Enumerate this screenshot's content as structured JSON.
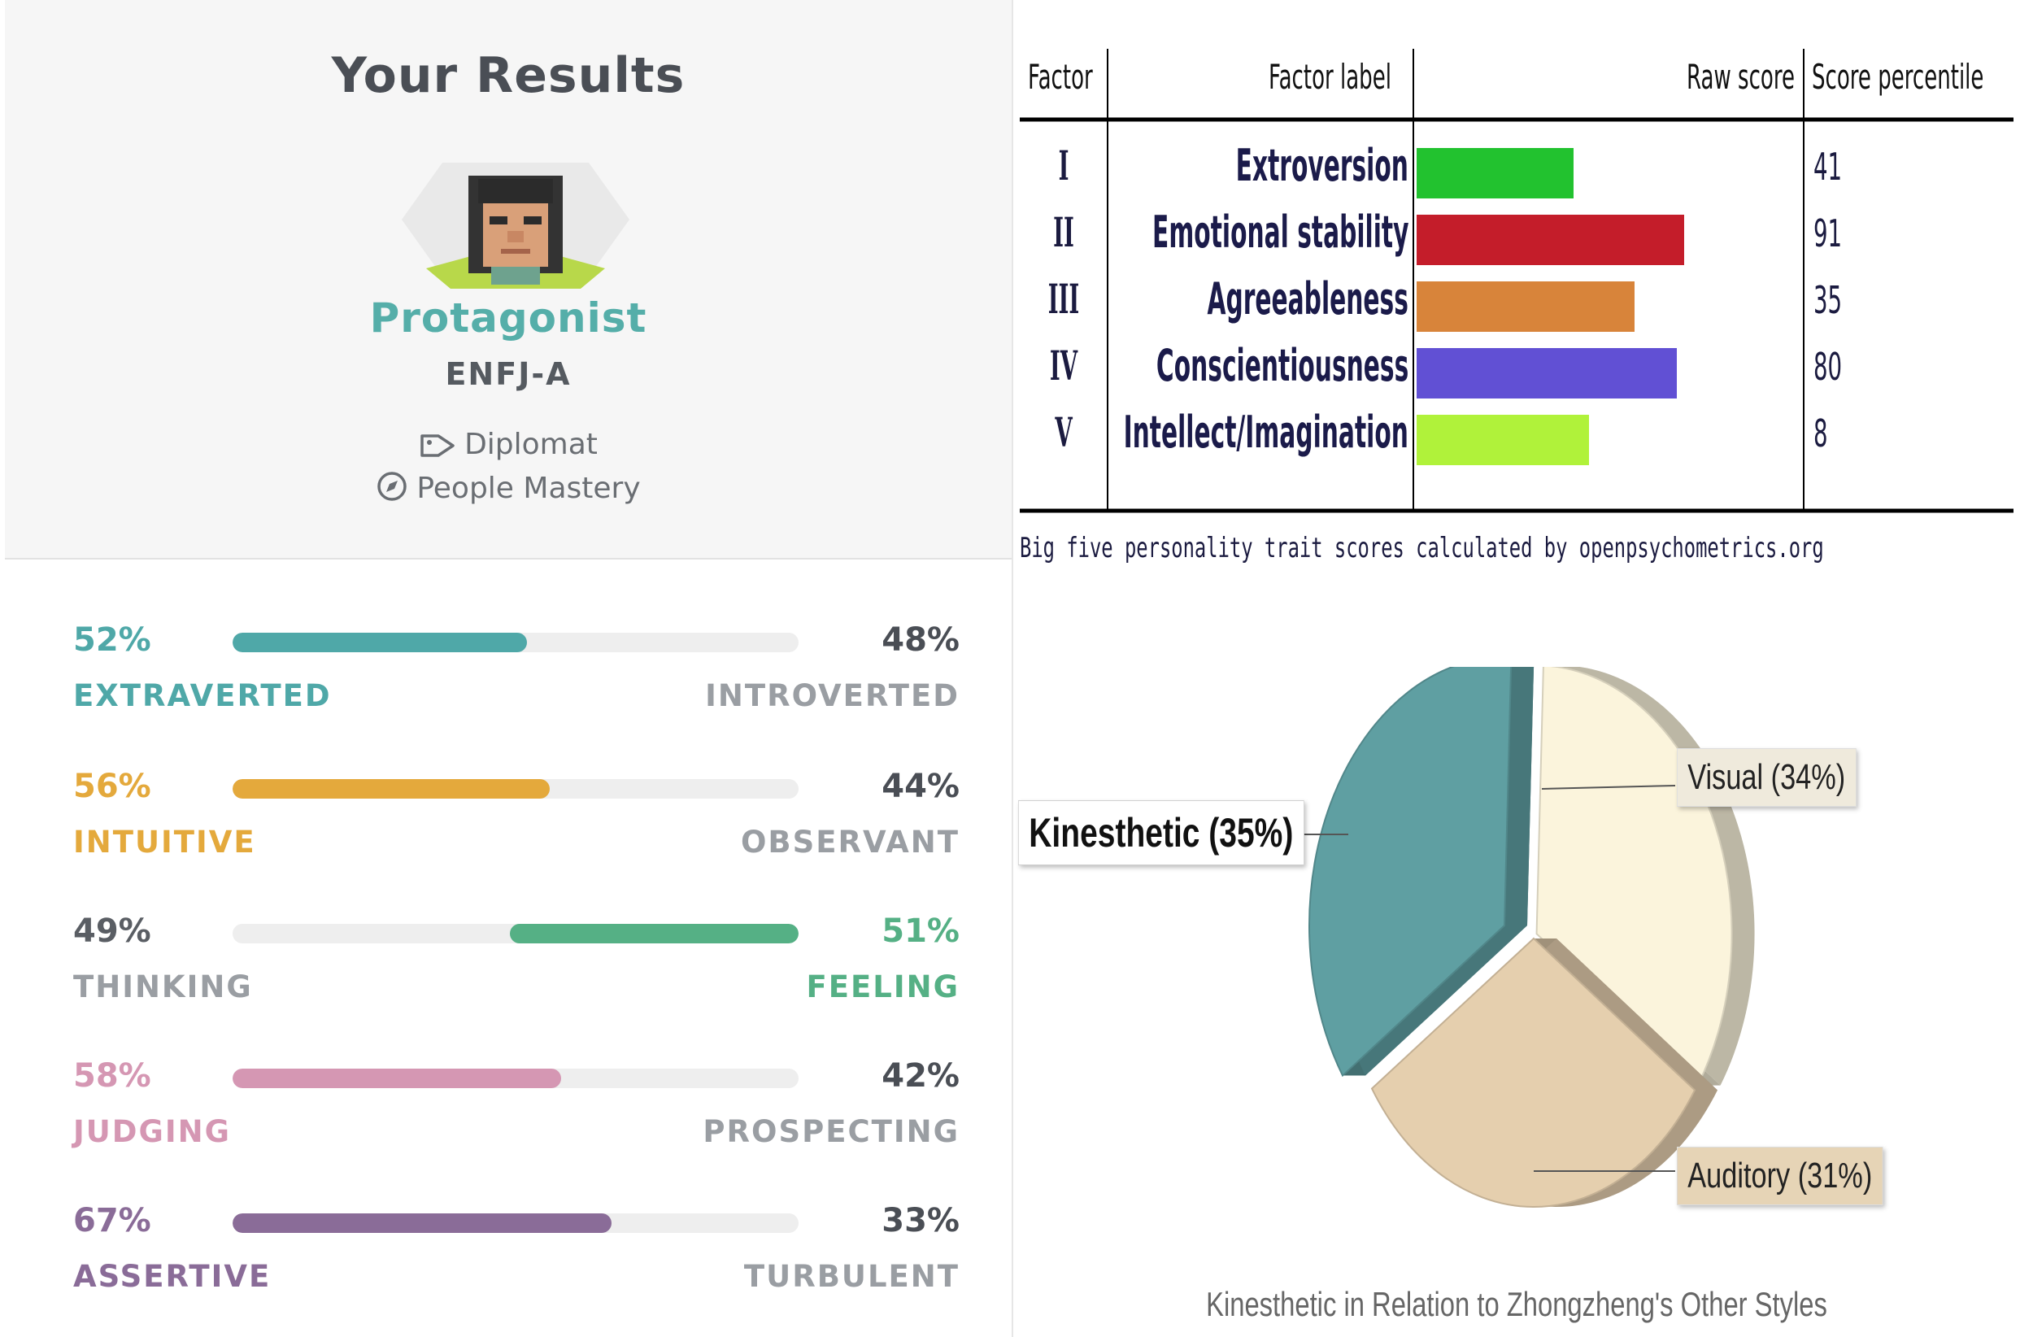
{
  "mbti": {
    "title": "Your Results",
    "type_name": "Protagonist",
    "type_code": "ENFJ-A",
    "role": "Diplomat",
    "strategy": "People Mastery",
    "traits": [
      {
        "left_pct": "52%",
        "left_label": "EXTRAVERTED",
        "right_pct": "48%",
        "right_label": "INTROVERTED",
        "value": 52,
        "side": "left",
        "color": "#4fa8a8"
      },
      {
        "left_pct": "56%",
        "left_label": "INTUITIVE",
        "right_pct": "44%",
        "right_label": "OBSERVANT",
        "value": 56,
        "side": "left",
        "color": "#e4a93c"
      },
      {
        "left_pct": "49%",
        "left_label": "THINKING",
        "right_pct": "51%",
        "right_label": "FEELING",
        "value": 51,
        "side": "right",
        "color": "#55b085"
      },
      {
        "left_pct": "58%",
        "left_label": "JUDGING",
        "right_pct": "42%",
        "right_label": "PROSPECTING",
        "value": 58,
        "side": "left",
        "color": "#d597b3"
      },
      {
        "left_pct": "67%",
        "left_label": "ASSERTIVE",
        "right_pct": "33%",
        "right_label": "TURBULENT",
        "value": 67,
        "side": "left",
        "color": "#8a6c98"
      }
    ]
  },
  "chart_data": [
    {
      "type": "bar",
      "headers": [
        "Factor",
        "Factor label",
        "Raw score",
        "Score percentile"
      ],
      "categories": [
        "Extroversion",
        "Emotional stability",
        "Agreeableness",
        "Conscientiousness",
        "Intellect/Imagination"
      ],
      "factors": [
        "I",
        "II",
        "III",
        "IV",
        "V"
      ],
      "values": [
        41,
        91,
        35,
        80,
        8
      ],
      "bar_lengths": [
        41,
        70,
        57,
        68,
        45
      ],
      "colors": [
        "#22c22f",
        "#c41d2a",
        "#d8843a",
        "#6150d4",
        "#b0f23a"
      ],
      "caption": "Big five personality trait scores calculated by openpsychometrics.org"
    },
    {
      "type": "pie",
      "title": "Kinesthetic in Relation to Zhongzheng's Other Styles",
      "slices": [
        {
          "label": "Kinesthetic (35%)",
          "value": 35,
          "color": "#5f9fa2"
        },
        {
          "label": "Visual (34%)",
          "value": 34,
          "color": "#fbf4dc"
        },
        {
          "label": "Auditory (31%)",
          "value": 31,
          "color": "#e5cfae"
        }
      ]
    }
  ]
}
